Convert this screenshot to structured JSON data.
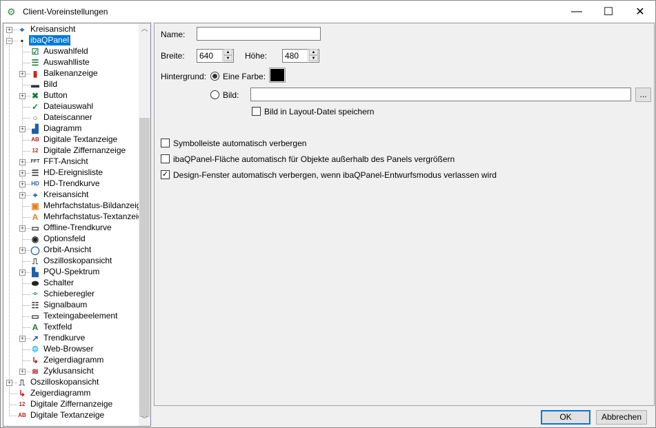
{
  "window": {
    "title": "Client-Voreinstellungen",
    "minimize": "—",
    "maximize": "☐",
    "close": "✕"
  },
  "tree": {
    "items": [
      {
        "label": "Kreisansicht",
        "level": 0,
        "exp": "+",
        "icon": "circle-view-icon",
        "glyph": "⌖",
        "color": "#1c5fa8"
      },
      {
        "label": "ibaQPanel",
        "level": 0,
        "exp": "−",
        "icon": "ibaqpanel-icon",
        "glyph": "▪",
        "color": "#222",
        "selected": true
      },
      {
        "label": "Auswahlfeld",
        "level": 1,
        "icon": "checkbox-field-icon",
        "glyph": "☑",
        "color": "#1e7a3c"
      },
      {
        "label": "Auswahlliste",
        "level": 1,
        "icon": "selection-list-icon",
        "glyph": "☰",
        "color": "#1e7a3c"
      },
      {
        "label": "Balkenanzeige",
        "level": 1,
        "exp": "+",
        "icon": "bar-display-icon",
        "glyph": "▮",
        "color": "#d02020"
      },
      {
        "label": "Bild",
        "level": 1,
        "icon": "image-icon",
        "glyph": "▬",
        "color": "#333"
      },
      {
        "label": "Button",
        "level": 1,
        "exp": "+",
        "icon": "button-icon",
        "glyph": "✖",
        "color": "#1e7a3c"
      },
      {
        "label": "Dateiauswahl",
        "level": 1,
        "icon": "file-select-icon",
        "glyph": "✓",
        "color": "#1e7a3c"
      },
      {
        "label": "Dateiscanner",
        "level": 1,
        "icon": "file-scanner-icon",
        "glyph": "○",
        "color": "#1e7a3c"
      },
      {
        "label": "Diagramm",
        "level": 1,
        "exp": "+",
        "icon": "diagram-icon",
        "glyph": "▟",
        "color": "#1c5fa8"
      },
      {
        "label": "Digitale Textanzeige",
        "level": 1,
        "icon": "digital-text-icon",
        "glyph": "AB",
        "color": "#c02020"
      },
      {
        "label": "Digitale Ziffernanzeige",
        "level": 1,
        "icon": "digital-number-icon",
        "glyph": "12",
        "color": "#c02020"
      },
      {
        "label": "FFT-Ansicht",
        "level": 1,
        "exp": "+",
        "icon": "fft-icon",
        "glyph": "FFT",
        "color": "#333"
      },
      {
        "label": "HD-Ereignisliste",
        "level": 1,
        "exp": "+",
        "icon": "hd-event-list-icon",
        "glyph": "☰",
        "color": "#333"
      },
      {
        "label": "HD-Trendkurve",
        "level": 1,
        "exp": "+",
        "icon": "hd-trend-icon",
        "glyph": "HD",
        "color": "#1c5fa8"
      },
      {
        "label": "Kreisansicht",
        "level": 1,
        "exp": "+",
        "icon": "circle-view-icon",
        "glyph": "⌖",
        "color": "#1c5fa8"
      },
      {
        "label": "Mehrfachstatus-Bildanzeige",
        "level": 1,
        "icon": "multistate-image-icon",
        "glyph": "▣",
        "color": "#e08020"
      },
      {
        "label": "Mehrfachstatus-Textanzeige",
        "level": 1,
        "icon": "multistate-text-icon",
        "glyph": "A",
        "color": "#e08020"
      },
      {
        "label": "Offline-Trendkurve",
        "level": 1,
        "exp": "+",
        "icon": "offline-trend-icon",
        "glyph": "▭",
        "color": "#333"
      },
      {
        "label": "Optionsfeld",
        "level": 1,
        "icon": "radio-option-icon",
        "glyph": "◉",
        "color": "#222"
      },
      {
        "label": "Orbit-Ansicht",
        "level": 1,
        "exp": "+",
        "icon": "orbit-icon",
        "glyph": "◯",
        "color": "#1c5fa8"
      },
      {
        "label": "Oszilloskopansicht",
        "level": 1,
        "icon": "oscilloscope-icon",
        "glyph": "⎍",
        "color": "#333"
      },
      {
        "label": "PQU-Spektrum",
        "level": 1,
        "exp": "+",
        "icon": "pqu-spectrum-icon",
        "glyph": "▙",
        "color": "#1c5fa8"
      },
      {
        "label": "Schalter",
        "level": 1,
        "icon": "switch-icon",
        "glyph": "⬬",
        "color": "#222"
      },
      {
        "label": "Schieberegler",
        "level": 1,
        "icon": "slider-icon",
        "glyph": "-o-",
        "color": "#1e7a3c"
      },
      {
        "label": "Signalbaum",
        "level": 1,
        "icon": "signal-tree-icon",
        "glyph": "☷",
        "color": "#333"
      },
      {
        "label": "Texteingabeelement",
        "level": 1,
        "icon": "text-input-icon",
        "glyph": "▭",
        "color": "#333"
      },
      {
        "label": "Textfeld",
        "level": 1,
        "icon": "text-field-icon",
        "glyph": "A",
        "color": "#1e7a3c"
      },
      {
        "label": "Trendkurve",
        "level": 1,
        "exp": "+",
        "icon": "trend-curve-icon",
        "glyph": "↗",
        "color": "#1c5fa8"
      },
      {
        "label": "Web-Browser",
        "level": 1,
        "icon": "web-browser-icon",
        "glyph": "🌐",
        "color": "#333"
      },
      {
        "label": "Zeigerdiagramm",
        "level": 1,
        "icon": "phasor-diagram-icon",
        "glyph": "↳",
        "color": "#c02020"
      },
      {
        "label": "Zyklusansicht",
        "level": 1,
        "exp": "+",
        "icon": "cycle-view-icon",
        "glyph": "≋",
        "color": "#c02020"
      },
      {
        "label": "Oszilloskopansicht",
        "level": 0,
        "exp": "+",
        "icon": "oscilloscope-icon",
        "glyph": "⎍",
        "color": "#333"
      },
      {
        "label": "Zeigerdiagramm",
        "level": 0,
        "icon": "phasor-diagram-icon",
        "glyph": "↳",
        "color": "#c02020"
      },
      {
        "label": "Digitale Ziffernanzeige",
        "level": 0,
        "icon": "digital-number-icon",
        "glyph": "12",
        "color": "#c02020"
      },
      {
        "label": "Digitale Textanzeige",
        "level": 0,
        "icon": "digital-text-icon",
        "glyph": "AB",
        "color": "#c02020"
      }
    ]
  },
  "form": {
    "name_label": "Name:",
    "name_value": "",
    "width_label": "Breite:",
    "width_value": "640",
    "height_label": "Höhe:",
    "height_value": "480",
    "background_label": "Hintergrund:",
    "color_option": "Eine Farbe:",
    "color_value": "#000000",
    "image_option": "Bild:",
    "image_value": "",
    "browse": "...",
    "save_image": "Bild in Layout-Datei speichern",
    "opt1": "Symbolleiste automatisch verbergen",
    "opt2": "ibaQPanel-Fläche automatisch für Objekte außerhalb des Panels vergrößern",
    "opt3": "Design-Fenster automatisch verbergen, wenn ibaQPanel-Entwurfsmodus verlassen wird"
  },
  "footer": {
    "ok": "OK",
    "cancel": "Abbrechen"
  }
}
